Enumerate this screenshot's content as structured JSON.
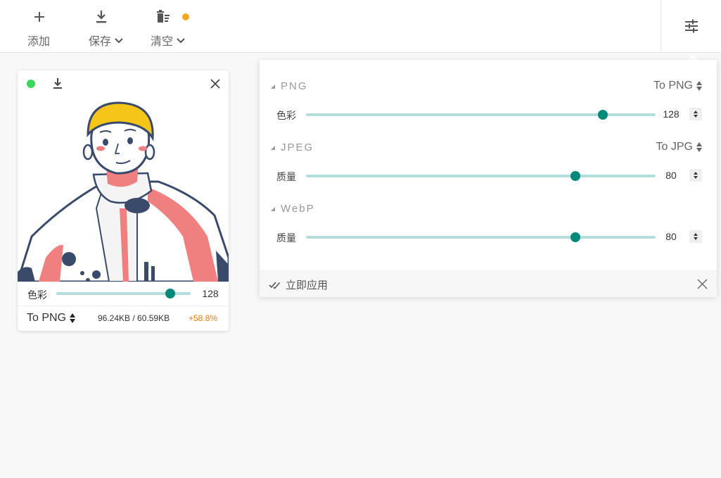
{
  "toolbar": {
    "add_label": "添加",
    "save_label": "保存",
    "clear_label": "清空",
    "badge_color": "#f5a623"
  },
  "card": {
    "status_color": "#3dd65a",
    "slider_label": "色彩",
    "slider_value": "128",
    "slider_level": 0.85,
    "format_label": "To PNG",
    "sizes": "96.24KB / 60.59KB",
    "change": "+58.8%",
    "change_color": "#f57c00"
  },
  "panel": {
    "sections": [
      {
        "title": "PNG",
        "select": "To PNG",
        "label": "色彩",
        "value": "128",
        "level": 0.85
      },
      {
        "title": "JPEG",
        "select": "To JPG",
        "label": "质量",
        "value": "80",
        "level": 0.77
      },
      {
        "title": "WebP",
        "label": "质量",
        "value": "80",
        "level": 0.77
      }
    ],
    "apply_label": "立即应用"
  },
  "colors": {
    "accent": "#00897b",
    "track": "#b2dfdb"
  }
}
